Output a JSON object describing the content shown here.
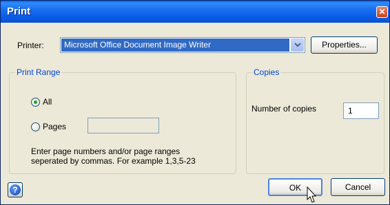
{
  "window": {
    "title": "Print",
    "close_glyph": "✕"
  },
  "printer": {
    "label": "Printer:",
    "selected": "Microsoft Office Document Image Writer",
    "properties_label": "Properties..."
  },
  "print_range": {
    "legend": "Print Range",
    "all_label": "All",
    "pages_label": "Pages",
    "pages_value": "",
    "selected": "All",
    "hint_line1": "Enter page numbers and/or page ranges",
    "hint_line2": "seperated by commas. For example 1,3,5-23"
  },
  "copies": {
    "legend": "Copies",
    "label": "Number of copies",
    "value": "1"
  },
  "buttons": {
    "ok": "OK",
    "cancel": "Cancel",
    "help_glyph": "?"
  },
  "colors": {
    "accent": "#0046d5",
    "selection": "#316ac5",
    "radio_checked": "#21a121"
  },
  "icons": [
    "close-icon",
    "chevron-down-icon",
    "help-icon",
    "mouse-cursor-icon"
  ]
}
